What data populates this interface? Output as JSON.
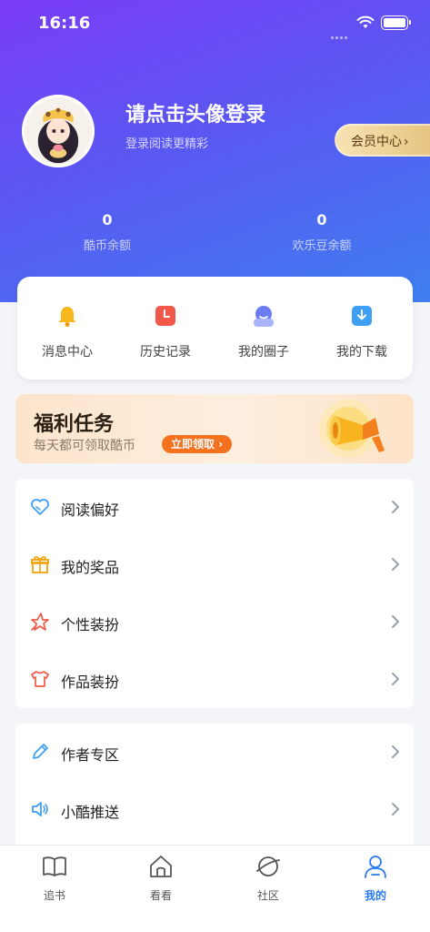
{
  "status_bar": {
    "time": "16:16"
  },
  "profile": {
    "login_title": "请点击头像登录",
    "login_subtitle": "登录阅读更精彩",
    "vip_button_label": "会员中心"
  },
  "balances": [
    {
      "value": "0",
      "label": "酷币余额"
    },
    {
      "value": "0",
      "label": "欢乐豆余额"
    }
  ],
  "quick_actions": [
    {
      "label": "消息中心",
      "icon": "bell-icon"
    },
    {
      "label": "历史记录",
      "icon": "clock-icon"
    },
    {
      "label": "我的圈子",
      "icon": "person-icon"
    },
    {
      "label": "我的下载",
      "icon": "download-icon"
    }
  ],
  "welfare": {
    "title": "福利任务",
    "subtitle": "每天都可领取酷币",
    "button_label": "立即领取"
  },
  "menu_group_1": [
    {
      "label": "阅读偏好",
      "icon": "heart-icon"
    },
    {
      "label": "我的奖品",
      "icon": "gift-icon"
    },
    {
      "label": "个性装扮",
      "icon": "star-icon"
    },
    {
      "label": "作品装扮",
      "icon": "shirt-icon"
    }
  ],
  "menu_group_2": [
    {
      "label": "作者专区",
      "icon": "pen-icon"
    },
    {
      "label": "小酷推送",
      "icon": "speaker-icon"
    }
  ],
  "tabbar": [
    {
      "label": "追书",
      "icon": "book-icon",
      "active": false
    },
    {
      "label": "看看",
      "icon": "home-icon",
      "active": false
    },
    {
      "label": "社区",
      "icon": "planet-icon",
      "active": false
    },
    {
      "label": "我的",
      "icon": "user-icon",
      "active": true
    }
  ],
  "colors": {
    "header_gradient_start": "#7b3cf6",
    "header_gradient_end": "#3f7ff0",
    "accent_blue": "#2a7af2",
    "welfare_button": "#f3711f",
    "vip_gold": "#e6c37f"
  }
}
